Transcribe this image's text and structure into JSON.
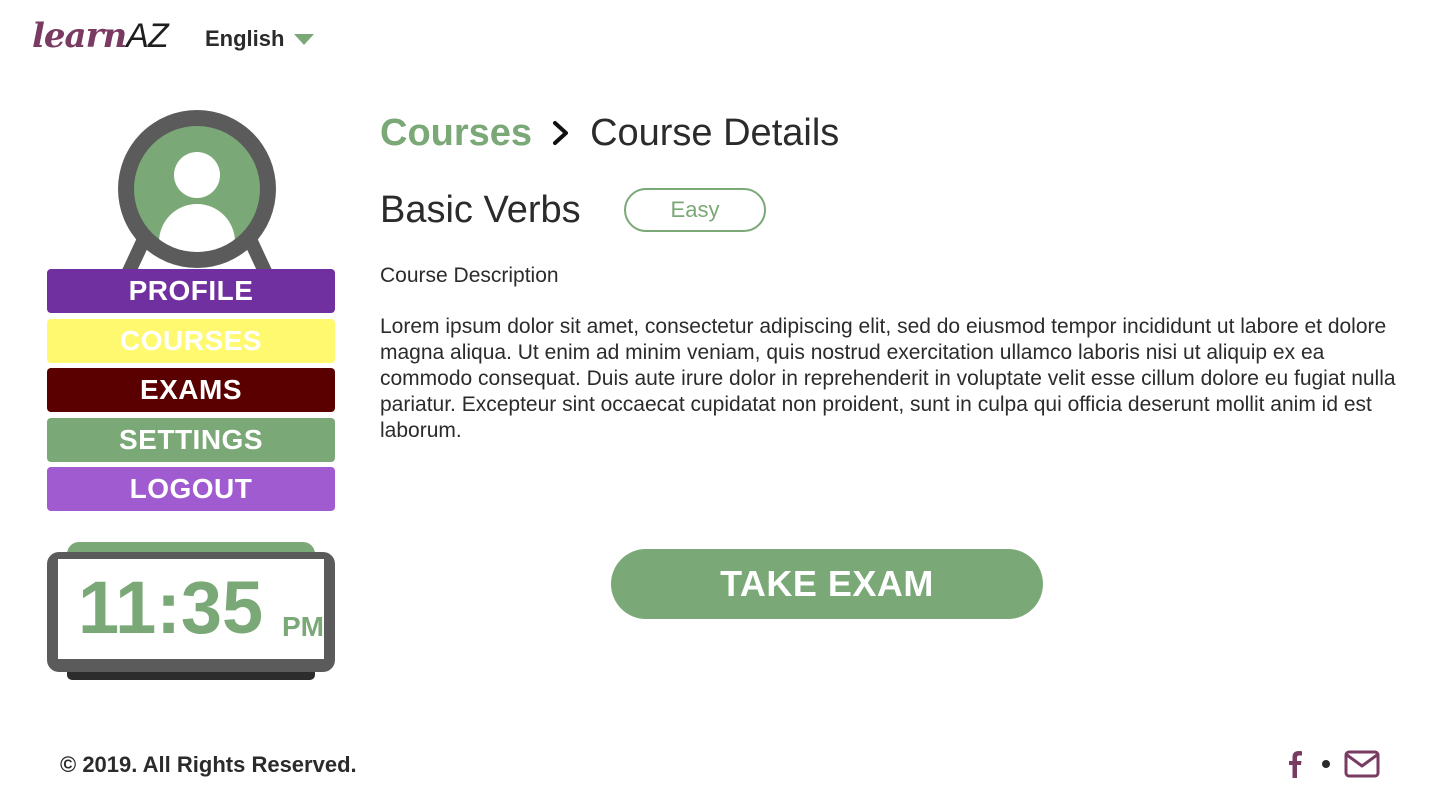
{
  "header": {
    "logo_learn": "learn",
    "logo_az": "AZ",
    "language": "English"
  },
  "sidebar": {
    "nav": [
      {
        "label": "PROFILE",
        "color": "#7130a0"
      },
      {
        "label": "COURSES",
        "color": "#fef96e"
      },
      {
        "label": "EXAMS",
        "color": "#5a0000"
      },
      {
        "label": "SETTINGS",
        "color": "#7ba877"
      },
      {
        "label": "LOGOUT",
        "color": "#a15bd1"
      }
    ],
    "clock": {
      "time": "11:35",
      "ampm": "PM"
    }
  },
  "main": {
    "breadcrumb": {
      "parent": "Courses",
      "current": "Course Details"
    },
    "course_title": "Basic Verbs",
    "difficulty": "Easy",
    "description_heading": "Course Description",
    "description": "Lorem ipsum dolor sit amet, consectetur adipiscing elit, sed do eiusmod tempor incididunt ut labore et dolore magna aliqua. Ut enim ad minim veniam, quis nostrud exercitation ullamco laboris nisi ut aliquip ex ea commodo consequat. Duis aute irure dolor in reprehenderit in voluptate velit esse cillum dolore eu fugiat nulla pariatur. Excepteur sint occaecat cupidatat non proident, sunt in culpa qui officia deserunt mollit anim id est laborum.",
    "take_exam": "TAKE EXAM"
  },
  "footer": {
    "copyright": "© 2019. All Rights Reserved.",
    "icons": [
      "facebook-icon",
      "email-icon"
    ]
  },
  "colors": {
    "accent_green": "#7ba877",
    "brand_purple": "#7a3b63",
    "dark_gray": "#5b5b5b"
  }
}
